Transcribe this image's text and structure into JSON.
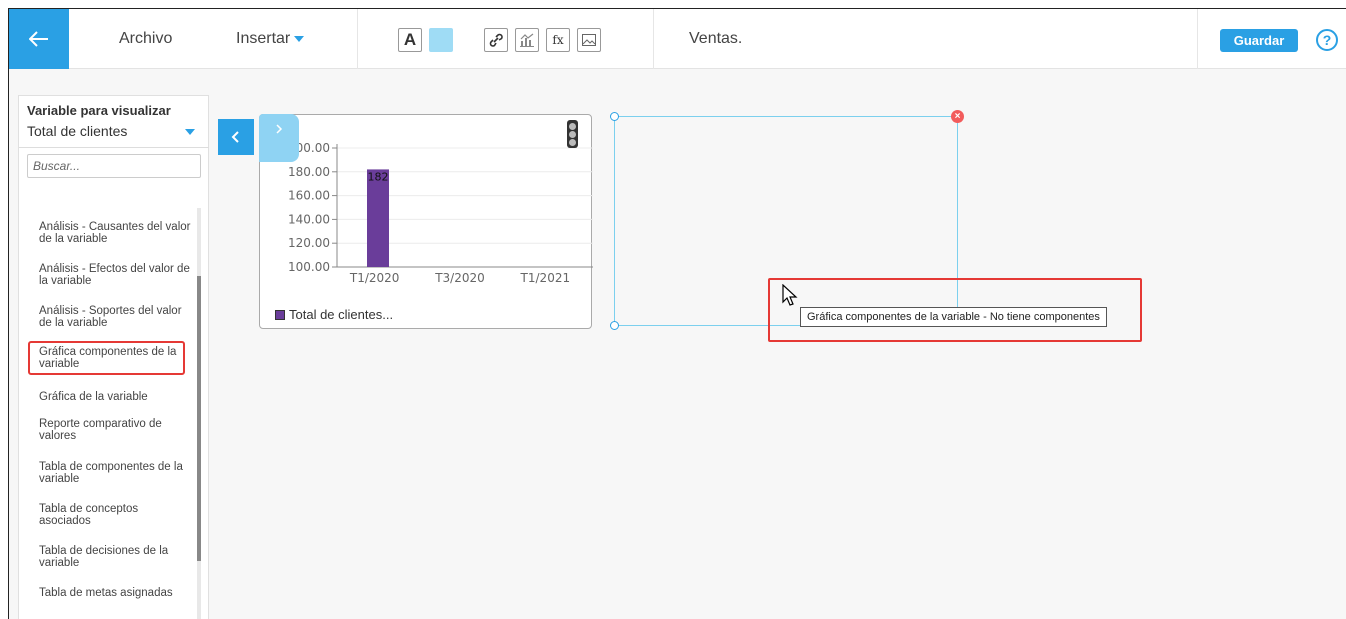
{
  "topbar": {
    "menu": {
      "archivo": "Archivo",
      "insertar": "Insertar"
    },
    "toolbar_icons": [
      "text-icon",
      "color-swatch",
      "link-icon",
      "chart-icon",
      "formula-icon",
      "image-icon"
    ],
    "text_tool_label": "A",
    "formula_tool_label": "fx",
    "page_title": "Ventas.",
    "save_label": "Guardar",
    "help_label": "?"
  },
  "colors": {
    "accent": "#2aa0e4",
    "bar": "#6a3d9a",
    "highlight": "#e53935"
  },
  "left_panel": {
    "title": "Variable para visualizar",
    "selected_variable": "Total de clientes",
    "search_placeholder": "Buscar...",
    "items": [
      {
        "label": "Análisis - Causantes del valor de la variable"
      },
      {
        "label": "Análisis - Efectos del valor de la variable"
      },
      {
        "label": "Análisis - Soportes del valor de la variable"
      },
      {
        "label": "Gráfica componentes de la variable",
        "selected": true
      },
      {
        "label": "Gráfica de la variable"
      },
      {
        "label": "Reporte comparativo de valores"
      },
      {
        "label": "Tabla de componentes de la variable"
      },
      {
        "label": "Tabla de conceptos asociados"
      },
      {
        "label": "Tabla de decisiones de la variable"
      },
      {
        "label": "Tabla de metas asignadas"
      }
    ]
  },
  "chart_widget": {
    "legend": "Total de clientes..."
  },
  "chart_data": {
    "type": "bar",
    "categories": [
      "T1/2020",
      "T3/2020",
      "T1/2021"
    ],
    "series": [
      {
        "name": "Total de clientes...",
        "values": [
          182,
          null,
          null
        ]
      }
    ],
    "data_labels": [
      "182"
    ],
    "yticks": [
      "200.00",
      "180.00",
      "160.00",
      "140.00",
      "120.00",
      "100.00"
    ],
    "ylim": [
      100,
      200
    ],
    "grid": true,
    "legend_position": "bottom-left"
  },
  "tooltip": {
    "text": "Gráfica componentes de la variable - No tiene componentes"
  }
}
